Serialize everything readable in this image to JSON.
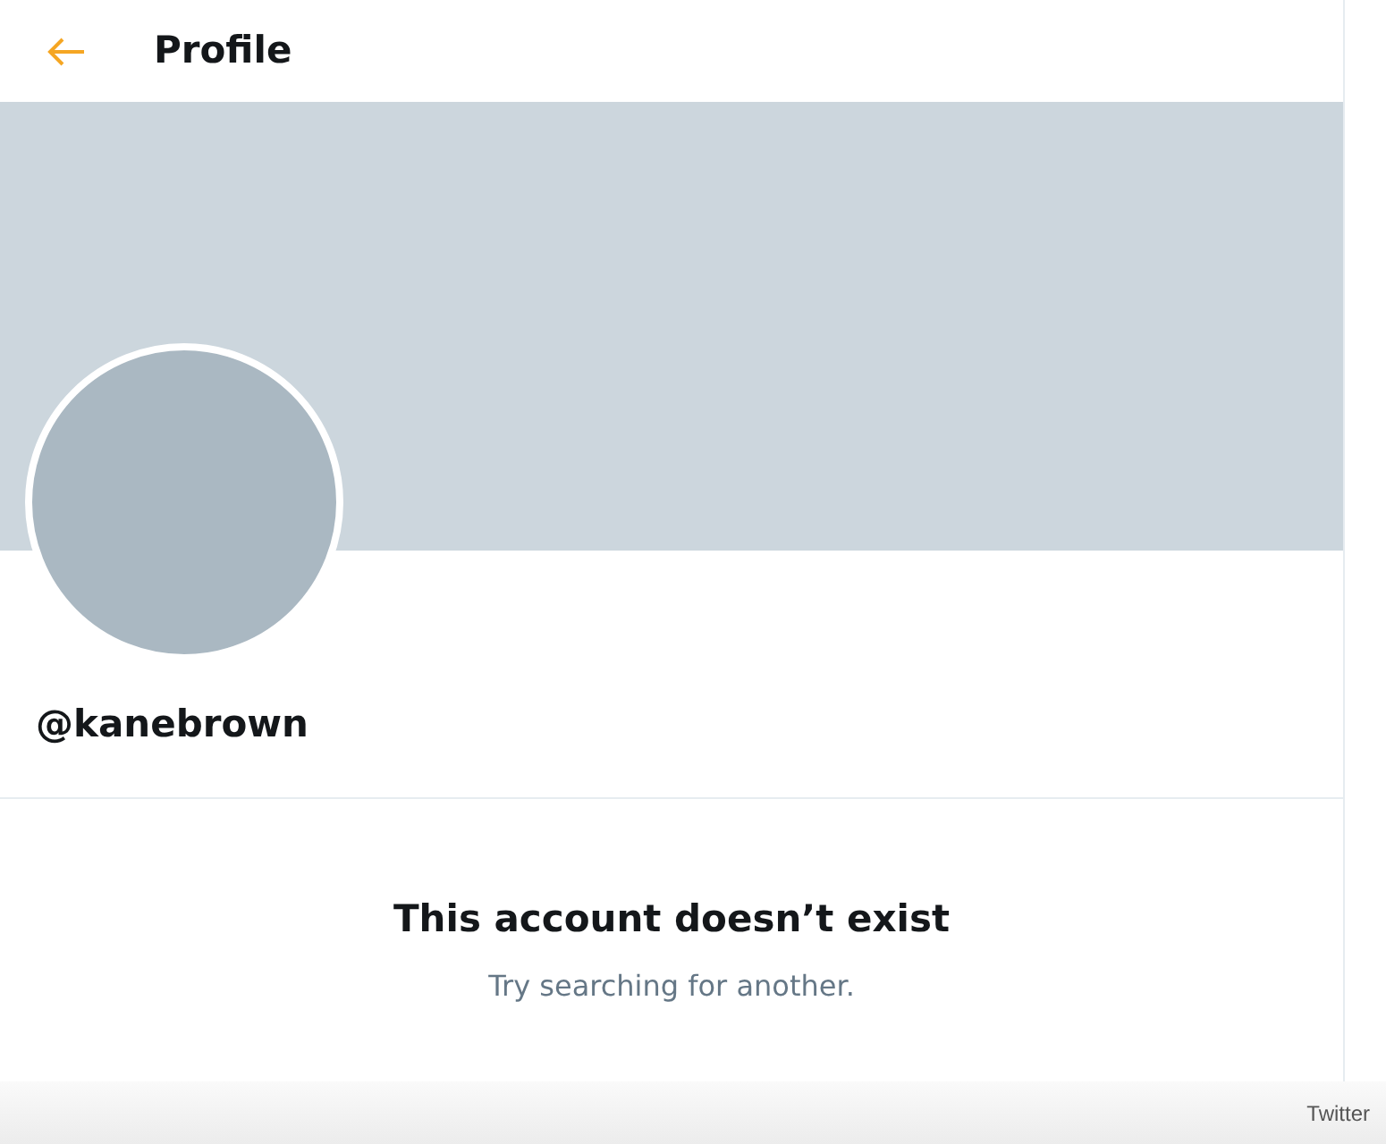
{
  "header": {
    "title": "Profile"
  },
  "profile": {
    "handle": "@kanebrown"
  },
  "notice": {
    "title": "This account doesn’t exist",
    "subtitle": "Try searching for another."
  },
  "credit": "Twitter"
}
